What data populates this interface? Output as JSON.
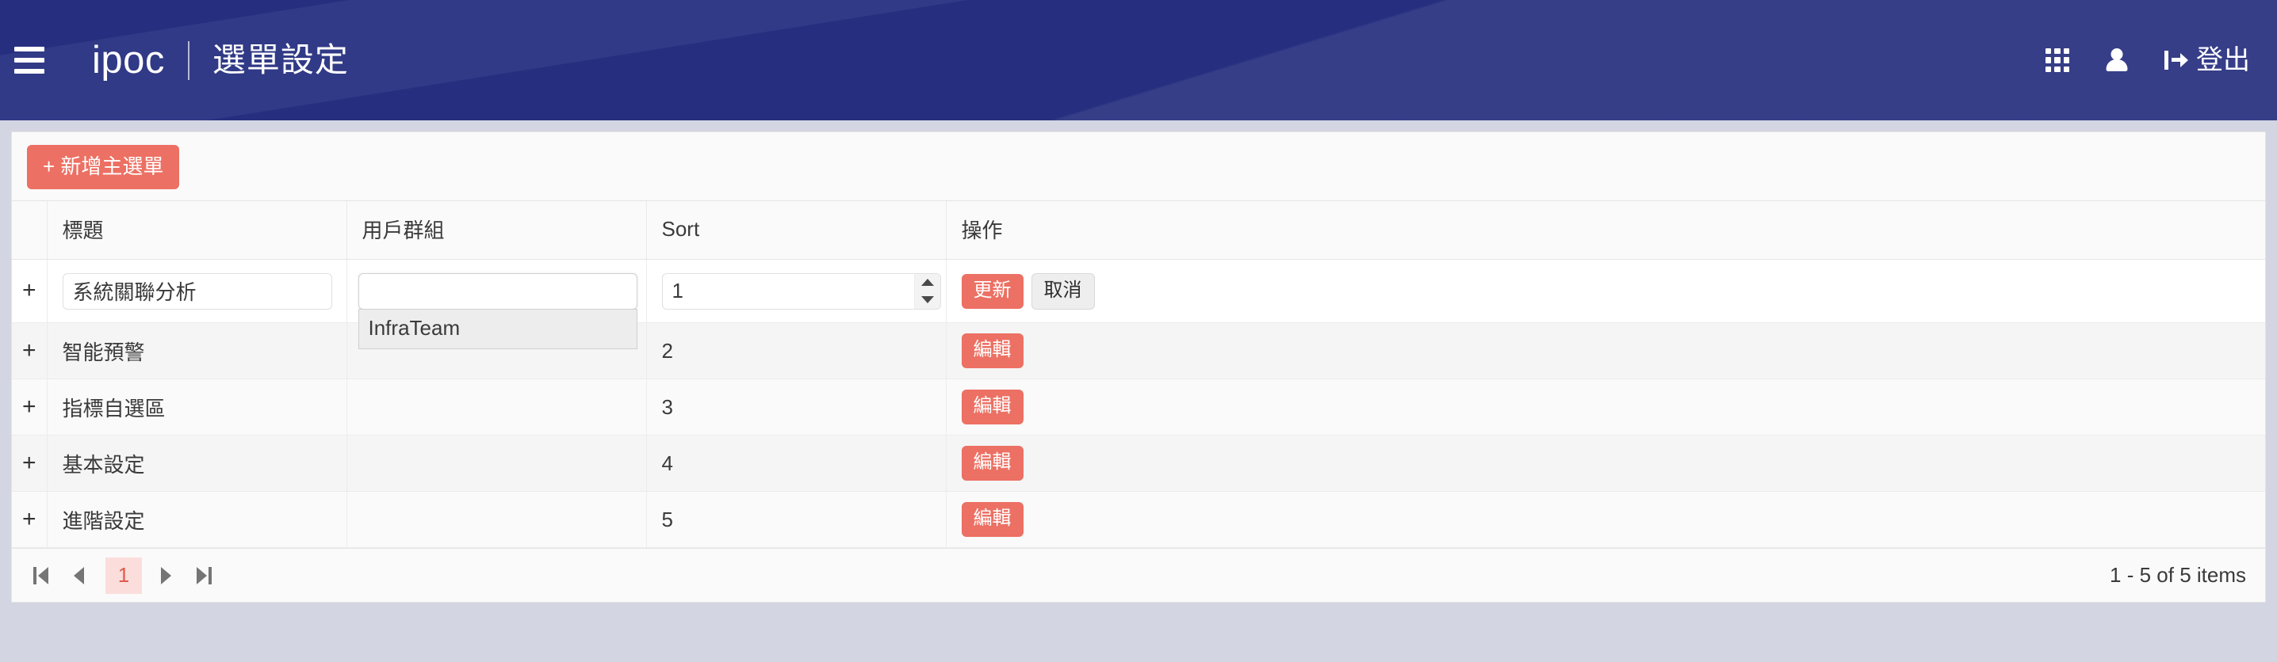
{
  "header": {
    "menu_icon": "hamburger-icon",
    "brand": "ipoc",
    "page_title": "選單設定",
    "apps_icon": "grid-apps-icon",
    "account_icon": "person-icon",
    "logout_icon": "logout-icon",
    "logout_label": "登出",
    "background_color": "#262f7f",
    "text_color": "#ffffff"
  },
  "toolbar": {
    "add_menu_label": "+ 新增主選單",
    "add_menu_color": "#ec7063"
  },
  "table": {
    "columns": [
      "",
      "標題",
      "用戶群組",
      "Sort",
      "操作"
    ],
    "edit_row": {
      "expander": "+",
      "title_value": "系統關聯分析",
      "title_placeholder": "",
      "group_value": "",
      "group_placeholder": "",
      "group_dropdown_open": true,
      "group_options": [
        "InfraTeam"
      ],
      "sort_value": "1",
      "update_label": "更新",
      "cancel_label": "取消"
    },
    "rows": [
      {
        "expander": "+",
        "title": "智能預警",
        "group": "",
        "sort": "2",
        "action_label": "編輯"
      },
      {
        "expander": "+",
        "title": "指標自選區",
        "group": "",
        "sort": "3",
        "action_label": "編輯"
      },
      {
        "expander": "+",
        "title": "基本設定",
        "group": "",
        "sort": "4",
        "action_label": "編輯"
      },
      {
        "expander": "+",
        "title": "進階設定",
        "group": "",
        "sort": "5",
        "action_label": "編輯"
      }
    ]
  },
  "pager": {
    "first_icon": "first-page-icon",
    "prev_icon": "previous-page-icon",
    "current_page": "1",
    "next_icon": "next-page-icon",
    "last_icon": "last-page-icon",
    "info": "1 - 5 of 5 items",
    "active_bg": "#fbdedb",
    "active_color": "#e4594b"
  }
}
